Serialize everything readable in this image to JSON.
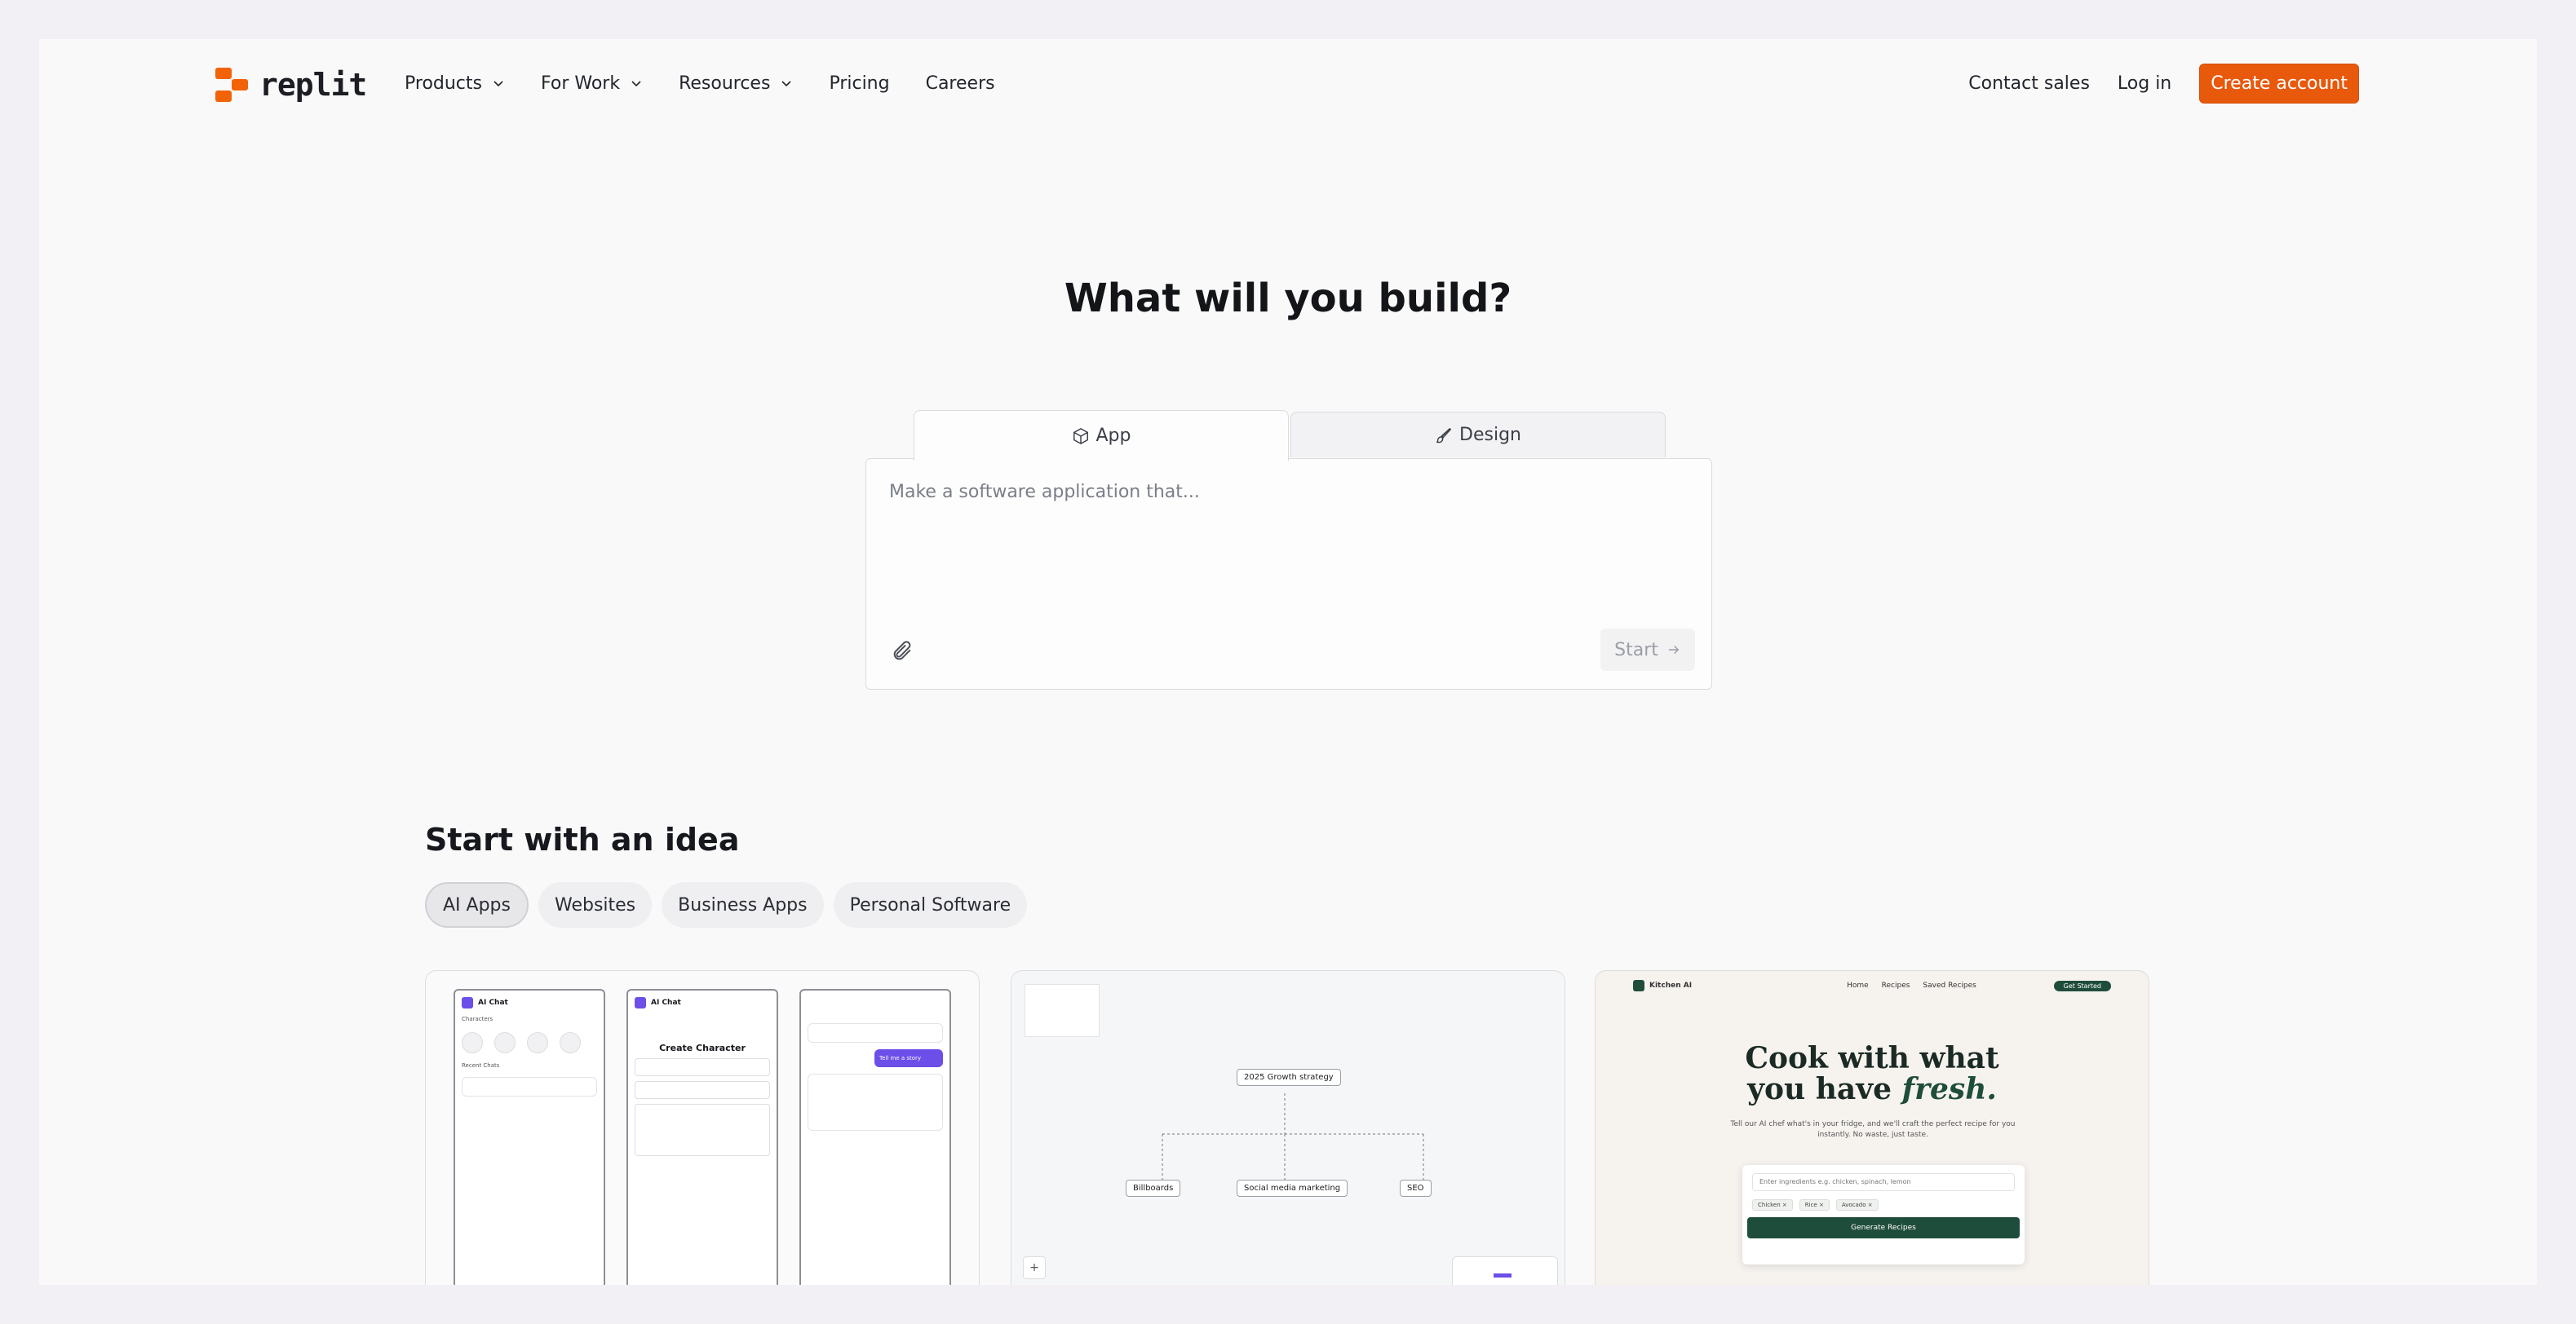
{
  "brand": {
    "name": "replit",
    "accent": "#f26207"
  },
  "nav": {
    "items": [
      {
        "label": "Products",
        "has_menu": true
      },
      {
        "label": "For Work",
        "has_menu": true
      },
      {
        "label": "Resources",
        "has_menu": true
      },
      {
        "label": "Pricing",
        "has_menu": false
      },
      {
        "label": "Careers",
        "has_menu": false
      }
    ],
    "contact_sales": "Contact sales",
    "log_in": "Log in",
    "create_account": "Create account"
  },
  "hero": {
    "title": "What will you build?",
    "tabs": [
      {
        "label": "App",
        "icon": "cube-icon",
        "active": true
      },
      {
        "label": "Design",
        "icon": "brush-icon",
        "active": false
      }
    ],
    "prompt_placeholder": "Make a software application that...",
    "start_label": "Start"
  },
  "ideas": {
    "title": "Start with an idea",
    "categories": [
      {
        "label": "AI Apps",
        "active": true
      },
      {
        "label": "Websites",
        "active": false
      },
      {
        "label": "Business Apps",
        "active": false
      },
      {
        "label": "Personal Software",
        "active": false
      }
    ],
    "cards": {
      "ai_chat": {
        "app_name": "AI Chat",
        "characters_label": "Characters",
        "recent_chats_label": "Recent Chats",
        "create_title": "Create Character",
        "sent_message": "Tell me a story"
      },
      "flow": {
        "root_node": "2025 Growth strategy",
        "child_nodes": [
          "Billboards",
          "Social media marketing",
          "SEO"
        ],
        "zoom_in": "+"
      },
      "recipe": {
        "app_name": "Kitchen AI",
        "nav_links": [
          "Home",
          "Recipes",
          "Saved Recipes"
        ],
        "nav_pill": "Get Started",
        "title_line1": "Cook with what",
        "title_line2_prefix": "you have ",
        "title_line2_em": "fresh.",
        "subtitle": "Tell our AI chef what's in your fridge, and we'll craft the perfect recipe for you instantly. No waste, just taste.",
        "input_placeholder": "Enter ingredients e.g. chicken, spinach, lemon",
        "tags": [
          "Chicken ×",
          "Rice ×",
          "Avocado ×"
        ],
        "button": "Generate Recipes",
        "brand_color": "#1f4d3b"
      }
    }
  }
}
